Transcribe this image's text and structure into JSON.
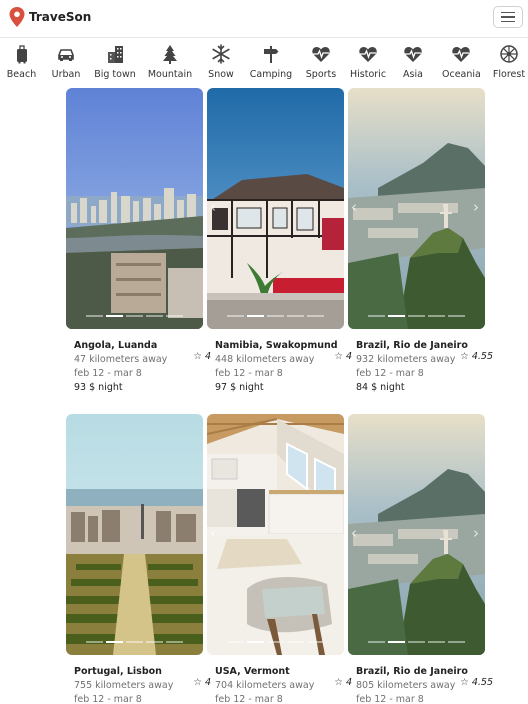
{
  "app": {
    "name": "TraveSon"
  },
  "categories": [
    {
      "label": "Beach",
      "icon": "suitcase-icon"
    },
    {
      "label": "Urban",
      "icon": "car-icon"
    },
    {
      "label": "Big town",
      "icon": "building-icon"
    },
    {
      "label": "Mountain",
      "icon": "tree-icon"
    },
    {
      "label": "Snow",
      "icon": "snowflake-icon"
    },
    {
      "label": "Camping",
      "icon": "signpost-icon"
    },
    {
      "label": "Sports",
      "icon": "heartbeat-icon"
    },
    {
      "label": "Historic",
      "icon": "heartbeat-icon"
    },
    {
      "label": "Asia",
      "icon": "heartbeat-icon"
    },
    {
      "label": "Oceania",
      "icon": "heartbeat-icon"
    },
    {
      "label": "Florest",
      "icon": "wheel-icon"
    }
  ],
  "listings": [
    {
      "title": "Angola, Luanda",
      "rating": "4",
      "distance": "47 kilometers away",
      "dates": "feb 12 - mar 8",
      "price": "93 $ night",
      "photo": "city-coast"
    },
    {
      "title": "Namibia, Swakopmund",
      "rating": "4",
      "distance": "448 kilometers away",
      "dates": "feb 12 - mar 8",
      "price": "97 $ night",
      "photo": "timber-house"
    },
    {
      "title": "Brazil, Rio de Janeiro",
      "rating": "4.55",
      "distance": "932 kilometers away",
      "dates": "feb 12 - mar 8",
      "price": "84 $ night",
      "photo": "rio-mountain"
    },
    {
      "title": "Portugal, Lisbon",
      "rating": "4",
      "distance": "755 kilometers away",
      "dates": "feb 12 - mar 8",
      "photo": "park-city"
    },
    {
      "title": "USA, Vermont",
      "rating": "4",
      "distance": "704 kilometers away",
      "dates": "feb 12 - mar 8",
      "photo": "attic-room"
    },
    {
      "title": "Brazil, Rio de Janeiro",
      "rating": "4.55",
      "distance": "805 kilometers away",
      "dates": "feb 12 - mar 8",
      "photo": "rio-mountain"
    }
  ]
}
